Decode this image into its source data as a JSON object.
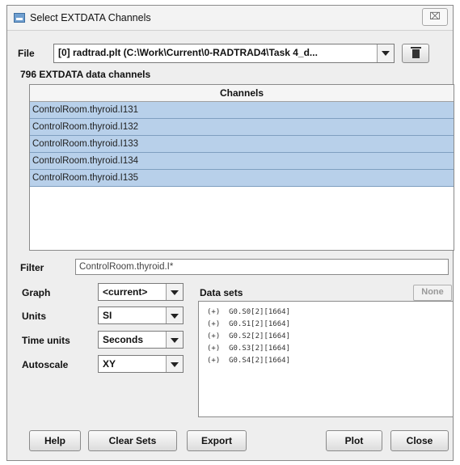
{
  "window": {
    "title": "Select EXTDATA Channels",
    "close_glyph": "⌧"
  },
  "file": {
    "label": "File",
    "value": "[0] radtrad.plt (C:\\Work\\Current\\0-RADTRAD4\\Task 4_d..."
  },
  "channel_count_text": "796 EXTDATA data channels",
  "channels": {
    "header": "Channels",
    "rows": [
      "ControlRoom.thyroid.I131",
      "ControlRoom.thyroid.I132",
      "ControlRoom.thyroid.I133",
      "ControlRoom.thyroid.I134",
      "ControlRoom.thyroid.I135"
    ]
  },
  "filter": {
    "label": "Filter",
    "value": "ControlRoom.thyroid.I*"
  },
  "graph": {
    "label": "Graph",
    "value": "<current>"
  },
  "units": {
    "label": "Units",
    "value": "SI"
  },
  "time_units": {
    "label": "Time units",
    "value": "Seconds"
  },
  "autoscale": {
    "label": "Autoscale",
    "value": "XY"
  },
  "data_sets": {
    "label": "Data sets",
    "none_label": "None",
    "items": [
      "(+)  G0.S0[2][1664]",
      "(+)  G0.S1[2][1664]",
      "(+)  G0.S2[2][1664]",
      "(+)  G0.S3[2][1664]",
      "(+)  G0.S4[2][1664]"
    ]
  },
  "buttons": {
    "help": "Help",
    "clear_sets": "Clear Sets",
    "export": "Export",
    "plot": "Plot",
    "close": "Close"
  },
  "colors": {
    "selection": "#b8d0ea",
    "window_bg": "#eeeeee"
  }
}
